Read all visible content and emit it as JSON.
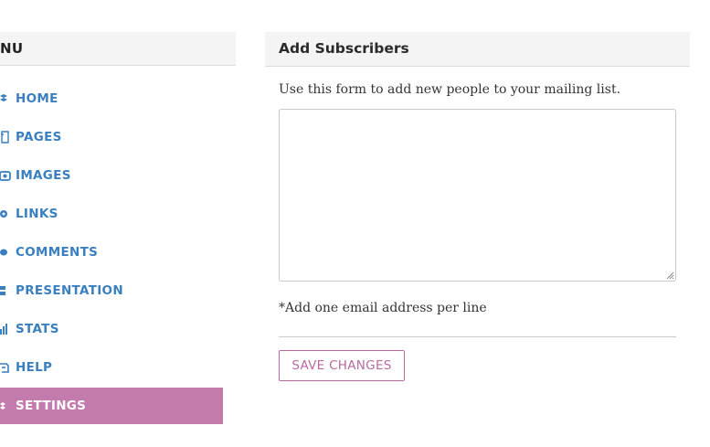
{
  "sidebar": {
    "title": "NU",
    "items": [
      {
        "label": "HOME",
        "icon": "gear-icon",
        "active": false
      },
      {
        "label": "PAGES",
        "icon": "page-icon",
        "active": false
      },
      {
        "label": "IMAGES",
        "icon": "camera-icon",
        "active": false
      },
      {
        "label": "LINKS",
        "icon": "link-icon",
        "active": false
      },
      {
        "label": "COMMENTS",
        "icon": "comment-icon",
        "active": false
      },
      {
        "label": "PRESENTATION",
        "icon": "layout-icon",
        "active": false
      },
      {
        "label": "STATS",
        "icon": "bar-chart-icon",
        "active": false
      },
      {
        "label": "HELP",
        "icon": "help-icon",
        "active": false
      },
      {
        "label": "SETTINGS",
        "icon": "gear-icon",
        "active": true
      }
    ]
  },
  "panel": {
    "title": "Add Subscribers",
    "intro": "Use this form to add new people to your mailing list.",
    "textarea_value": "",
    "hint": "*Add one email address per line",
    "save_label": "SAVE CHANGES"
  },
  "colors": {
    "link": "#3a7fbf",
    "active_bg": "#c37aad",
    "button_accent": "#b86aa0"
  }
}
